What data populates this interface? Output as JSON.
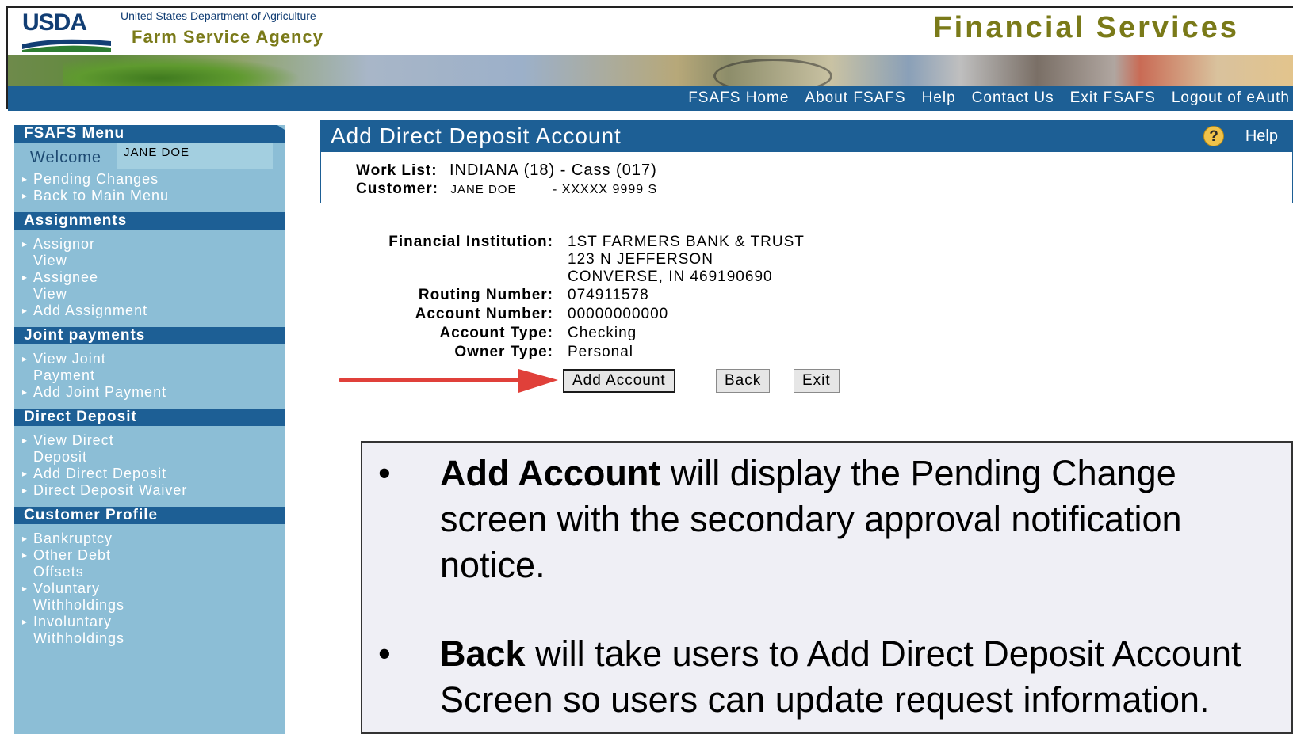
{
  "header": {
    "logo_text": "USDA",
    "department": "United States Department of Agriculture",
    "agency": "Farm Service Agency",
    "app_title": "Financial Services"
  },
  "nav": {
    "links": [
      "FSAFS Home",
      "About FSAFS",
      "Help",
      "Contact Us",
      "Exit FSAFS",
      "Logout of eAuth"
    ]
  },
  "sidebar": {
    "menu_title": "FSAFS Menu",
    "welcome_label": "Welcome",
    "user_name": "JANE DOE",
    "menu_items": [
      "Pending Changes",
      "Back to Main Menu"
    ],
    "sections": [
      {
        "title": "Assignments",
        "items": [
          "Assignor View",
          "Assignee View",
          "Add Assignment"
        ]
      },
      {
        "title": "Joint payments",
        "items": [
          "View Joint Payment",
          "Add Joint Payment"
        ]
      },
      {
        "title": "Direct Deposit",
        "items": [
          "View Direct Deposit",
          "Add Direct Deposit",
          "Direct Deposit Waiver"
        ]
      },
      {
        "title": "Customer Profile",
        "items": [
          "Bankruptcy",
          "Other Debt Offsets",
          "Voluntary Withholdings",
          "Involuntary Withholdings"
        ]
      }
    ]
  },
  "main": {
    "title": "Add Direct Deposit Account",
    "help_label": "Help",
    "work_list_label": "Work List:",
    "work_list_value": "INDIANA (18) - Cass (017)",
    "customer_label": "Customer:",
    "customer_name": "JANE DOE",
    "customer_id": "- XXXXX 9999 S"
  },
  "details": {
    "financial_institution_label": "Financial Institution:",
    "financial_institution_lines": [
      "1ST FARMERS BANK & TRUST",
      "123 N JEFFERSON",
      "CONVERSE, IN 469190690"
    ],
    "routing_label": "Routing Number:",
    "routing_value": "074911578",
    "account_label": "Account Number:",
    "account_value": "00000000000",
    "account_type_label": "Account Type:",
    "account_type_value": "Checking",
    "owner_type_label": "Owner Type:",
    "owner_type_value": "Personal"
  },
  "buttons": {
    "add_account": "Add Account",
    "back": "Back",
    "exit": "Exit"
  },
  "callout": {
    "bullet_1_bold": "Add Account",
    "bullet_1_rest": " will display the Pending Change screen with the secondary approval notification notice.",
    "bullet_2_bold": "Back",
    "bullet_2_rest": " will take users to Add Direct Deposit Account Screen so users can update request information."
  },
  "colors": {
    "nav_blue": "#1d5f95",
    "sidebar_blue": "#8cbed6",
    "agency_olive": "#7a7a19",
    "arrow_red": "#e0403a"
  }
}
